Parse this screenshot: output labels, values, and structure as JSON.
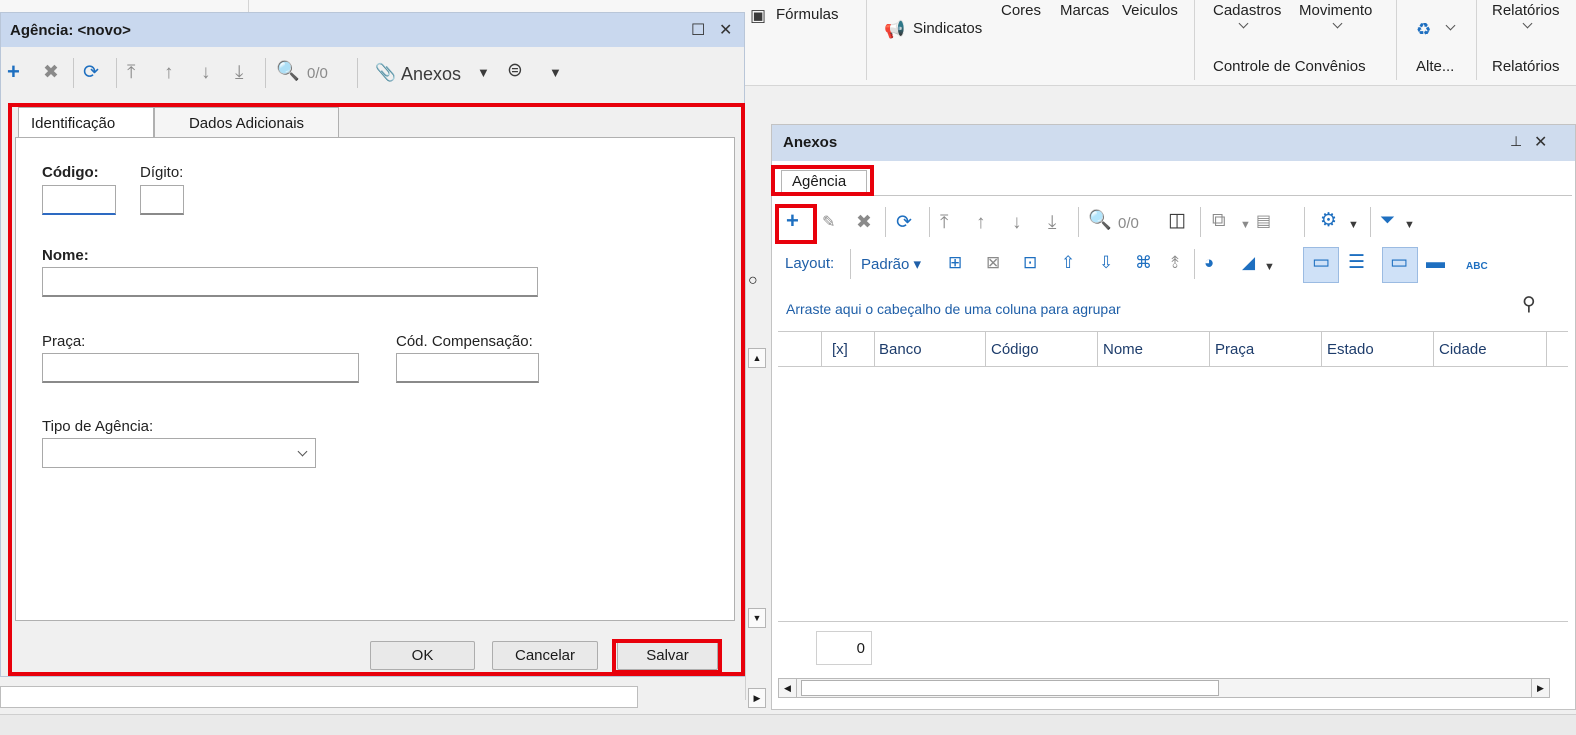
{
  "ribbon": {
    "formulas": "Fórmulas",
    "sindicatos": "Sindicatos",
    "cores": "Cores",
    "marcas": "Marcas",
    "veiculos": "Veiculos",
    "cadastros": "Cadastros",
    "movimento": "Movimento",
    "relatorios": "Relatórios",
    "group_convenios": "Controle de Convênios",
    "group_alte": "Alte...",
    "group_relatorios": "Relatórios"
  },
  "dialog": {
    "title": "Agência: <novo>",
    "counter": "0/0",
    "anexos_label": "Anexos",
    "tabs": [
      "Identificação",
      "Dados Adicionais"
    ],
    "fields": {
      "codigo_label": "Código",
      "digito_label": "Dígito:",
      "nome_label": "Nome",
      "praca_label": "Praça:",
      "cod_comp_label": "Cód. Compensação:",
      "tipo_agencia_label": "Tipo de Agência:"
    },
    "buttons": {
      "ok": "OK",
      "cancel": "Cancelar",
      "save": "Salvar"
    }
  },
  "anexos_panel": {
    "title": "Anexos",
    "tab": "Agência",
    "counter": "0/0",
    "layout_label": "Layout:",
    "layout_value": "Padrão",
    "group_hint": "Arraste aqui o cabeçalho de uma coluna para agrupar",
    "columns": [
      "[x]",
      "Banco",
      "Código",
      "Nome",
      "Praça",
      "Estado",
      "Cidade"
    ],
    "footer_count": "0"
  },
  "colors": {
    "highlight": "#e8000b",
    "title_bar": "#c9d8ee",
    "accent": "#1e6fc0"
  }
}
